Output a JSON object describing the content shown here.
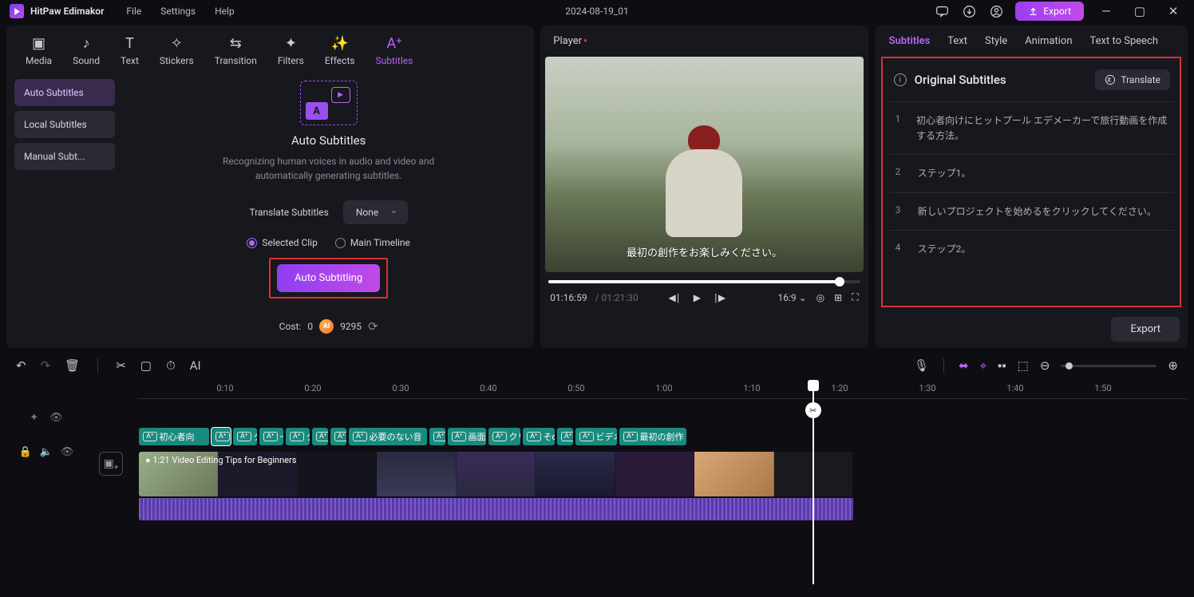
{
  "app": {
    "name": "HitPaw Edimakor",
    "document": "2024-08-19_01",
    "export": "Export"
  },
  "menu": [
    "File",
    "Settings",
    "Help"
  ],
  "tabs": [
    "Media",
    "Sound",
    "Text",
    "Stickers",
    "Transition",
    "Filters",
    "Effects",
    "Subtitles"
  ],
  "subSidebar": [
    "Auto Subtitles",
    "Local Subtitles",
    "Manual Subt..."
  ],
  "auto": {
    "title": "Auto Subtitles",
    "desc": "Recognizing human voices in audio and video and automatically generating subtitles.",
    "translateLabel": "Translate Subtitles",
    "translateValue": "None",
    "radio1": "Selected Clip",
    "radio2": "Main Timeline",
    "button": "Auto Subtitling",
    "costLabel": "Cost:",
    "costValue": "0",
    "credits": "9295"
  },
  "player": {
    "title": "Player",
    "caption": "最初の創作をお楽しみください。",
    "time": "01:16:59",
    "duration": "01:21:30",
    "ratio": "16:9"
  },
  "rightTabs": [
    "Subtitles",
    "Text",
    "Style",
    "Animation",
    "Text to Speech"
  ],
  "rightPanel": {
    "heading": "Original Subtitles",
    "translate": "Translate",
    "export": "Export",
    "items": [
      {
        "n": "1",
        "t": "初心者向けにヒットプール エデメーカーで旅行動画を作成する方法。"
      },
      {
        "n": "2",
        "t": "ステップ1。"
      },
      {
        "n": "3",
        "t": "新しいプロジェクトを始めるをクリックしてください。"
      },
      {
        "n": "4",
        "t": "ステップ2。"
      }
    ]
  },
  "ruler": [
    "0:10",
    "0:20",
    "0:30",
    "0:40",
    "0:50",
    "1:00",
    "1:10",
    "1:20",
    "1:30",
    "1:40",
    "1:50"
  ],
  "subClips": [
    "初心者向",
    "",
    "ク",
    "一",
    "タ",
    "",
    "",
    "必要のない音",
    "",
    "画面",
    "クリ",
    "そσ",
    "",
    "ビデオ",
    "最初の創作"
  ],
  "videoLabel": "1:21 Video Editing Tips for Beginners"
}
